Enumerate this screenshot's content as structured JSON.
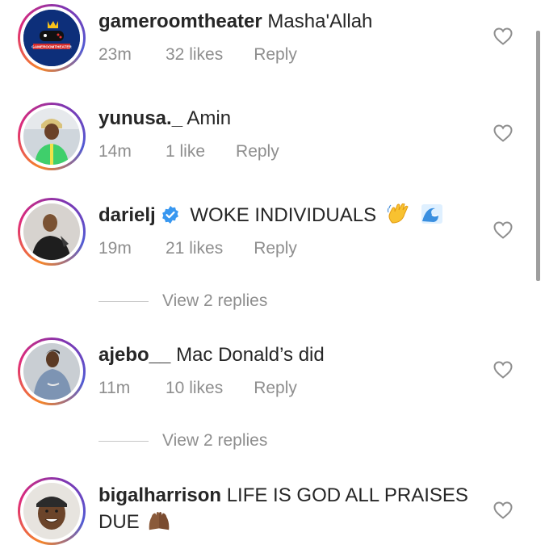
{
  "comments": [
    {
      "username": "gameroomtheater",
      "text": "Masha'Allah",
      "time": "23m",
      "likes": "32 likes",
      "reply": "Reply",
      "avatar_logo_text": "GAMEROOMTHEATER",
      "avatar": "gamepad-logo-avatar"
    },
    {
      "username": "yunusa._",
      "text": "Amin",
      "time": "14m",
      "likes": "1 like",
      "reply": "Reply",
      "avatar": "person-green-shirt-avatar"
    },
    {
      "username": "darielj",
      "verified": true,
      "text": "WOKE INDIVIDUALS",
      "emojis": [
        "waving-hand",
        "water-wave"
      ],
      "time": "19m",
      "likes": "21 likes",
      "reply": "Reply",
      "view_replies": "View 2 replies",
      "avatar": "person-black-jacket-avatar"
    },
    {
      "username": "ajebo__",
      "text": "Mac Donald’s did",
      "time": "11m",
      "likes": "10 likes",
      "reply": "Reply",
      "view_replies": "View 2 replies",
      "avatar": "person-denim-avatar"
    },
    {
      "username": "bigalharrison",
      "text_line1": "LIFE IS GOD ALL PRAISES",
      "text_line2": "DUE",
      "emojis": [
        "raised-hands-brown"
      ],
      "avatar": "smiling-man-cap-avatar"
    }
  ],
  "colors": {
    "text": "#262626",
    "secondary": "#8e8e8e",
    "verified": "#3897f0",
    "story_ring": [
      "#f58529",
      "#dd2a7b",
      "#8134af",
      "#515bd4"
    ]
  }
}
